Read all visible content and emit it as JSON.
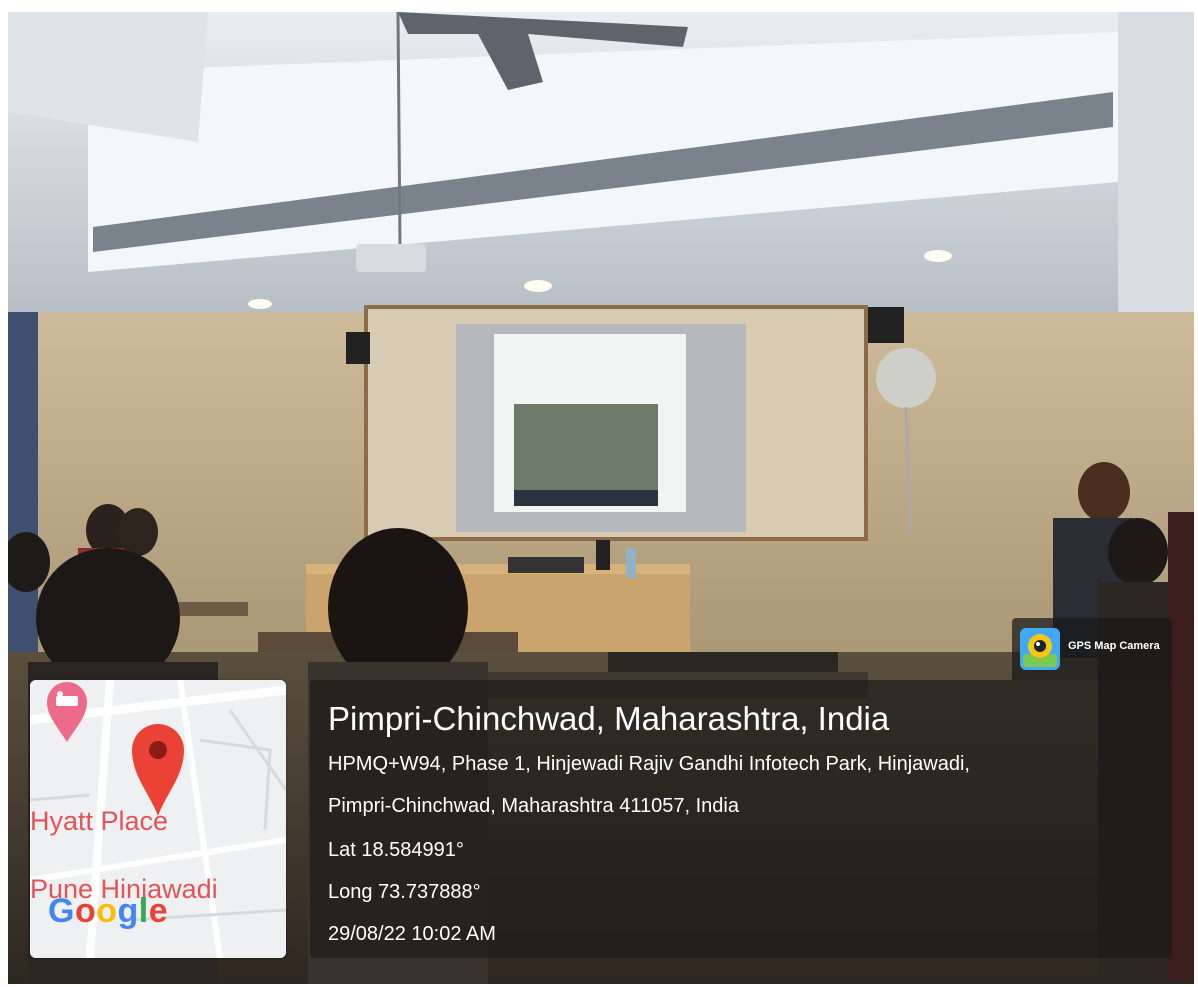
{
  "location": {
    "title": "Pimpri-Chinchwad, Maharashtra, India",
    "address_line_1": "HPMQ+W94, Phase 1, Hinjewadi Rajiv Gandhi Infotech Park, Hinjawadi,",
    "address_line_2": "Pimpri-Chinchwad, Maharashtra 411057, India",
    "latitude": "Lat 18.584991°",
    "longitude": "Long 73.737888°",
    "timestamp": "29/08/22 10:02 AM"
  },
  "map": {
    "place_line_1": "Hyatt Place",
    "place_line_2": "Pune Hinjawadi",
    "logo_text": "Google",
    "icons": [
      "hotel-pin-icon",
      "location-pin-icon"
    ]
  },
  "badge": {
    "label": "GPS Map Camera",
    "icon": "gps-map-camera-icon"
  },
  "colors": {
    "pin_red": "#ea4335",
    "map_label_red": "#e0545a",
    "hotel_pin_pink": "#ec6b8a",
    "panel_bg": "#191919"
  }
}
